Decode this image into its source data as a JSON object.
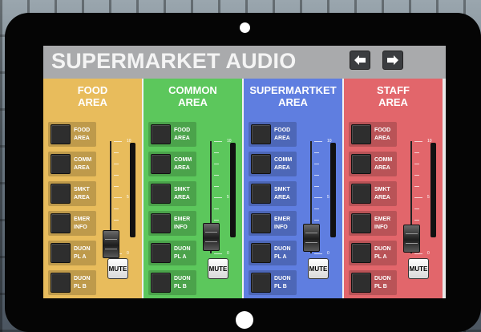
{
  "app": {
    "title": "SUPERMARKET AUDIO"
  },
  "nav": {
    "back_icon": "arrow-left-icon",
    "forward_icon": "arrow-right-icon"
  },
  "zones": [
    {
      "title_line1": "FOOD",
      "title_line2": "AREA",
      "color": "#e8bc5c",
      "sources": [
        {
          "l1": "FOOD",
          "l2": "AREA"
        },
        {
          "l1": "COMM",
          "l2": "AREA"
        },
        {
          "l1": "SMKT",
          "l2": "AREA"
        },
        {
          "l1": "EMER",
          "l2": "INFO"
        },
        {
          "l1": "DUON",
          "l2": "PL A"
        },
        {
          "l1": "DUON",
          "l2": "PL B"
        }
      ],
      "fader_level": 0.08,
      "mute_label": "MUTE"
    },
    {
      "title_line1": "COMMON",
      "title_line2": "AREA",
      "color": "#5cc75c",
      "sources": [
        {
          "l1": "FOOD",
          "l2": "AREA"
        },
        {
          "l1": "COMM",
          "l2": "AREA"
        },
        {
          "l1": "SMKT",
          "l2": "AREA"
        },
        {
          "l1": "EMER",
          "l2": "INFO"
        },
        {
          "l1": "DUON",
          "l2": "PL A"
        },
        {
          "l1": "DUON",
          "l2": "PL B"
        }
      ],
      "fader_level": 0.15,
      "mute_label": "MUTE"
    },
    {
      "title_line1": "SUPERMARTKET",
      "title_line2": "AREA",
      "color": "#5f7ee0",
      "sources": [
        {
          "l1": "FOOD",
          "l2": "AREA"
        },
        {
          "l1": "COMM",
          "l2": "AREA"
        },
        {
          "l1": "SMKT",
          "l2": "AREA"
        },
        {
          "l1": "EMER",
          "l2": "INFO"
        },
        {
          "l1": "DUON",
          "l2": "PL A"
        },
        {
          "l1": "DUON",
          "l2": "PL B"
        }
      ],
      "fader_level": 0.14,
      "mute_label": "MUTE"
    },
    {
      "title_line1": "STAFF",
      "title_line2": "AREA",
      "color": "#e2666b",
      "sources": [
        {
          "l1": "FOOD",
          "l2": "AREA"
        },
        {
          "l1": "COMM",
          "l2": "AREA"
        },
        {
          "l1": "SMKT",
          "l2": "AREA"
        },
        {
          "l1": "EMER",
          "l2": "INFO"
        },
        {
          "l1": "DUON",
          "l2": "PL A"
        },
        {
          "l1": "DUON",
          "l2": "PL B"
        }
      ],
      "fader_level": 0.13,
      "mute_label": "MUTE"
    }
  ],
  "fader_scale": [
    "10",
    "5",
    "0"
  ]
}
